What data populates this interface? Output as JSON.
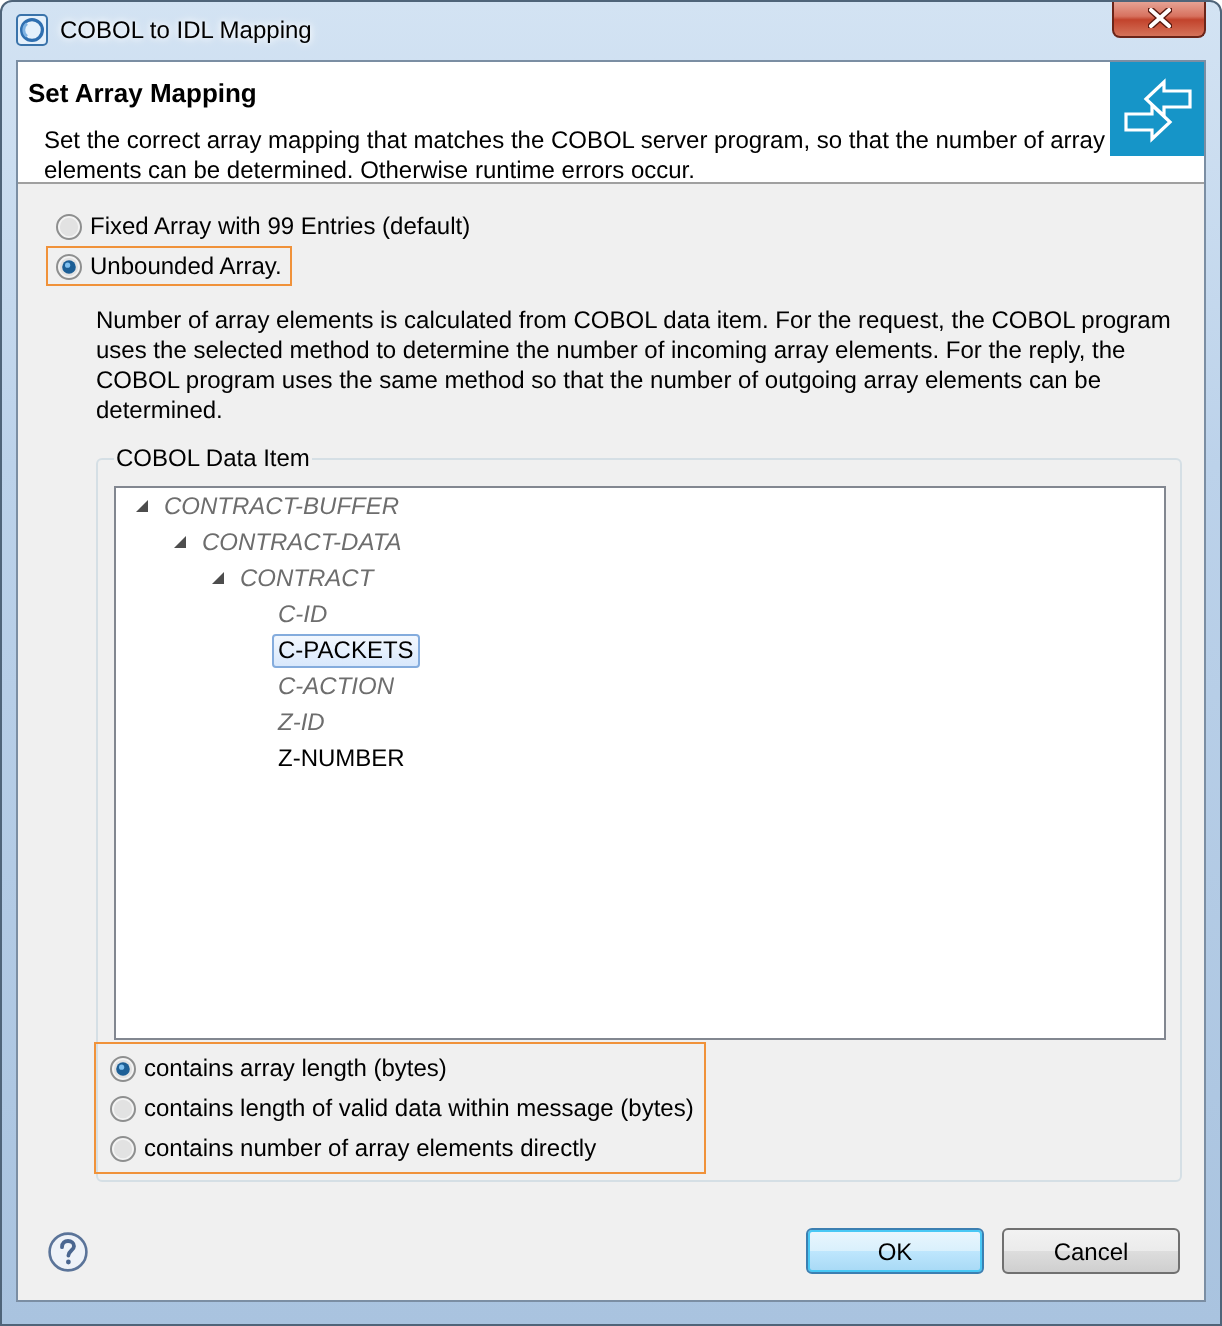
{
  "window": {
    "title": "COBOL to IDL Mapping"
  },
  "header": {
    "title": "Set Array Mapping",
    "description": "Set the correct array mapping that matches the COBOL server program, so that the number of array elements can be determined. Otherwise runtime errors occur."
  },
  "array_options": [
    {
      "label": "Fixed Array with 99 Entries (default)",
      "selected": false,
      "highlighted": false
    },
    {
      "label": "Unbounded Array.",
      "selected": true,
      "highlighted": true
    }
  ],
  "explanation": "Number of array elements is calculated from COBOL data item. For the request, the COBOL program uses the selected method to determine the number of incoming array elements. For the reply, the COBOL program uses the same method so that the number of outgoing array elements can be determined.",
  "data_item_group": {
    "title": "COBOL Data Item",
    "tree": [
      {
        "label": "CONTRACT-BUFFER",
        "disabled": true,
        "selected": false,
        "expanded": true,
        "children": [
          {
            "label": "CONTRACT-DATA",
            "disabled": true,
            "selected": false,
            "expanded": true,
            "children": [
              {
                "label": "CONTRACT",
                "disabled": true,
                "selected": false,
                "expanded": true,
                "children": [
                  {
                    "label": "C-ID",
                    "disabled": true,
                    "selected": false
                  },
                  {
                    "label": "C-PACKETS",
                    "disabled": false,
                    "selected": true
                  },
                  {
                    "label": "C-ACTION",
                    "disabled": true,
                    "selected": false
                  },
                  {
                    "label": "Z-ID",
                    "disabled": true,
                    "selected": false
                  },
                  {
                    "label": "Z-NUMBER",
                    "disabled": false,
                    "selected": false
                  }
                ]
              }
            ]
          }
        ]
      }
    ],
    "length_options": {
      "highlighted": true,
      "options": [
        {
          "label": "contains array length (bytes)",
          "selected": true
        },
        {
          "label": "contains length of valid data within message (bytes)",
          "selected": false
        },
        {
          "label": "contains number of array elements directly",
          "selected": false
        }
      ]
    }
  },
  "buttons": [
    {
      "label": "OK",
      "default": true
    },
    {
      "label": "Cancel",
      "default": false
    }
  ]
}
